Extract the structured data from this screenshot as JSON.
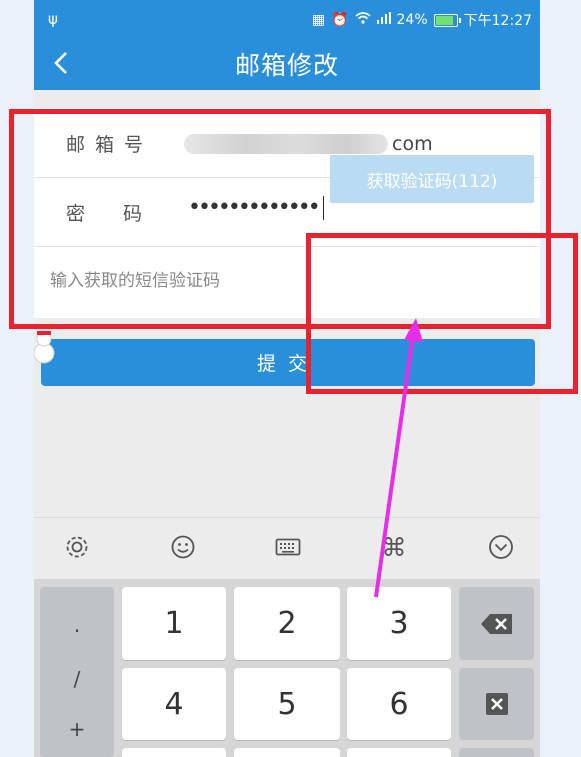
{
  "status_bar": {
    "usb_icon": "usb-icon",
    "battery": "24%",
    "time": "下午12:27"
  },
  "header": {
    "title": "邮箱修改",
    "back_icon": "chevron-left-icon"
  },
  "form": {
    "email_label": "邮箱号",
    "email_suffix": "com",
    "password_label_1": "密",
    "password_label_2": "码",
    "password_value": "•••••••••••••",
    "code_placeholder": "输入获取的短信验证码",
    "get_code_button": "获取验证码(112)"
  },
  "submit_button": "提交",
  "keyboard": {
    "toolbar_icons": [
      "gear-icon",
      "emoji-icon",
      "keyboard-icon",
      "command-icon",
      "collapse-icon"
    ],
    "command_glyph": "⌘",
    "symbols": [
      ".",
      "/",
      "+"
    ],
    "keys": [
      "1",
      "2",
      "3",
      "4",
      "5",
      "6"
    ]
  },
  "colors": {
    "primary": "#2a8fdb",
    "get_code_bg": "#b9dcf3",
    "annotation_red": "#e8232f",
    "annotation_arrow": "#e62ee6"
  }
}
